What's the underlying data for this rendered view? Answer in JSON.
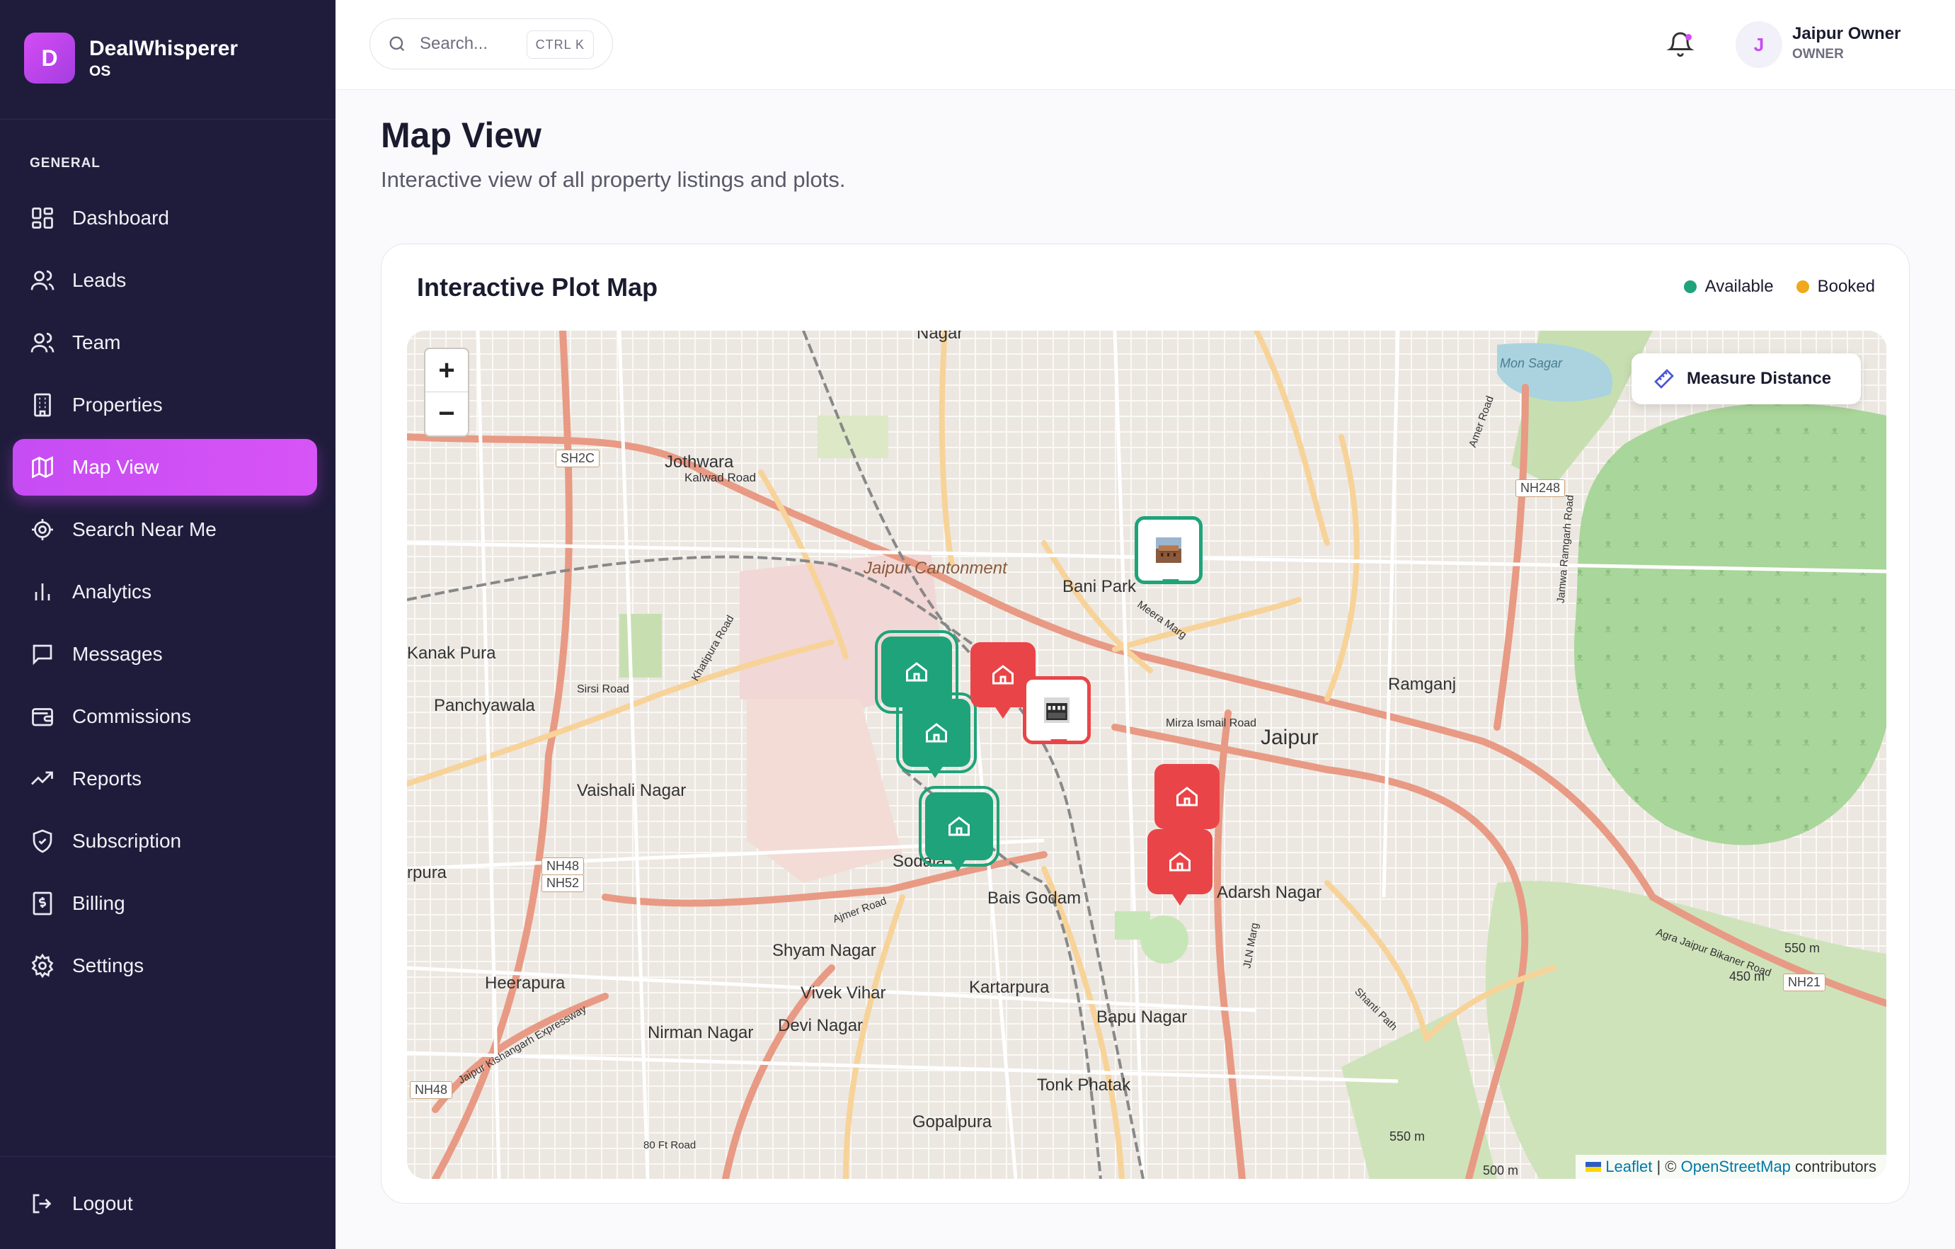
{
  "app": {
    "name": "DealWhisperer",
    "sub": "OS",
    "logo_letter": "D"
  },
  "sidebar": {
    "section": "GENERAL",
    "items": [
      {
        "label": "Dashboard",
        "icon": "dashboard-icon"
      },
      {
        "label": "Leads",
        "icon": "users-icon"
      },
      {
        "label": "Team",
        "icon": "team-icon"
      },
      {
        "label": "Properties",
        "icon": "building-icon"
      },
      {
        "label": "Map View",
        "icon": "map-icon",
        "active": true
      },
      {
        "label": "Search Near Me",
        "icon": "locate-icon"
      },
      {
        "label": "Analytics",
        "icon": "bar-chart-icon"
      },
      {
        "label": "Messages",
        "icon": "message-icon"
      },
      {
        "label": "Commissions",
        "icon": "wallet-icon"
      },
      {
        "label": "Reports",
        "icon": "trending-icon"
      },
      {
        "label": "Subscription",
        "icon": "shield-icon"
      },
      {
        "label": "Billing",
        "icon": "receipt-icon"
      },
      {
        "label": "Settings",
        "icon": "gear-icon"
      }
    ],
    "logout": "Logout"
  },
  "header": {
    "search_placeholder": "Search...",
    "shortcut": "CTRL K",
    "user": {
      "initial": "J",
      "name": "Jaipur Owner",
      "role": "OWNER"
    }
  },
  "page": {
    "title": "Map View",
    "subtitle": "Interactive view of all property listings and plots."
  },
  "card": {
    "title": "Interactive Plot Map",
    "legend": [
      {
        "label": "Available",
        "color": "#1fa37a"
      },
      {
        "label": "Booked",
        "color": "#f0a81c"
      }
    ]
  },
  "map": {
    "zoom_in": "+",
    "zoom_out": "−",
    "measure_label": "Measure Distance",
    "attribution": {
      "leaflet": "Leaflet",
      "sep": "| ©",
      "osm": "OpenStreetMap",
      "tail": "contributors"
    },
    "labels": {
      "jaipur": "Jaipur",
      "jothwara": "Jothwara",
      "kalwad": "Kalwad Road",
      "cantonment": "Jaipur Cantonment",
      "bani_park": "Bani Park",
      "kanak_pura": "Kanak Pura",
      "panchyawala": "Panchyawala",
      "ramganj": "Ramganj",
      "vaishali": "Vaishali Nagar",
      "sodala": "Sodala",
      "bais_godam": "Bais Godam",
      "adarsh": "Adarsh Nagar",
      "rpura": "rpura",
      "shyam": "Shyam Nagar",
      "kartarpura": "Kartarpura",
      "vivek": "Vivek Vihar",
      "heerapura": "Heerapura",
      "nirman": "Nirman Nagar",
      "devi": "Devi Nagar",
      "bapu": "Bapu Nagar",
      "tonk": "Tonk Phatak",
      "gopalpura": "Gopalpura",
      "mon_sagar": "Mon Sagar",
      "nagar": "Nagar",
      "elev1": "550 m",
      "elev2": "450 m",
      "elev3": "550 m",
      "elev4": "500 m",
      "sirsi": "Sirsi Road",
      "khatipura": "Khatipura Road",
      "mirza": "Mirza Ismail Road",
      "ajmer_rd": "Ajmer Road",
      "jlm": "JLN Marg",
      "ft80": "80 Ft Road",
      "expressway": "Jaipur Kishangarh Expressway",
      "agra": "Agra Jaipur Bikaner Road",
      "jamwa": "Jamwa Ramgarh Road",
      "amer": "Amer Road",
      "meera": "Meera Marg",
      "shanti": "Shanti Path"
    },
    "shields": [
      "SH2C",
      "NH248",
      "NH48",
      "NH52",
      "NH48",
      "NH21"
    ]
  }
}
